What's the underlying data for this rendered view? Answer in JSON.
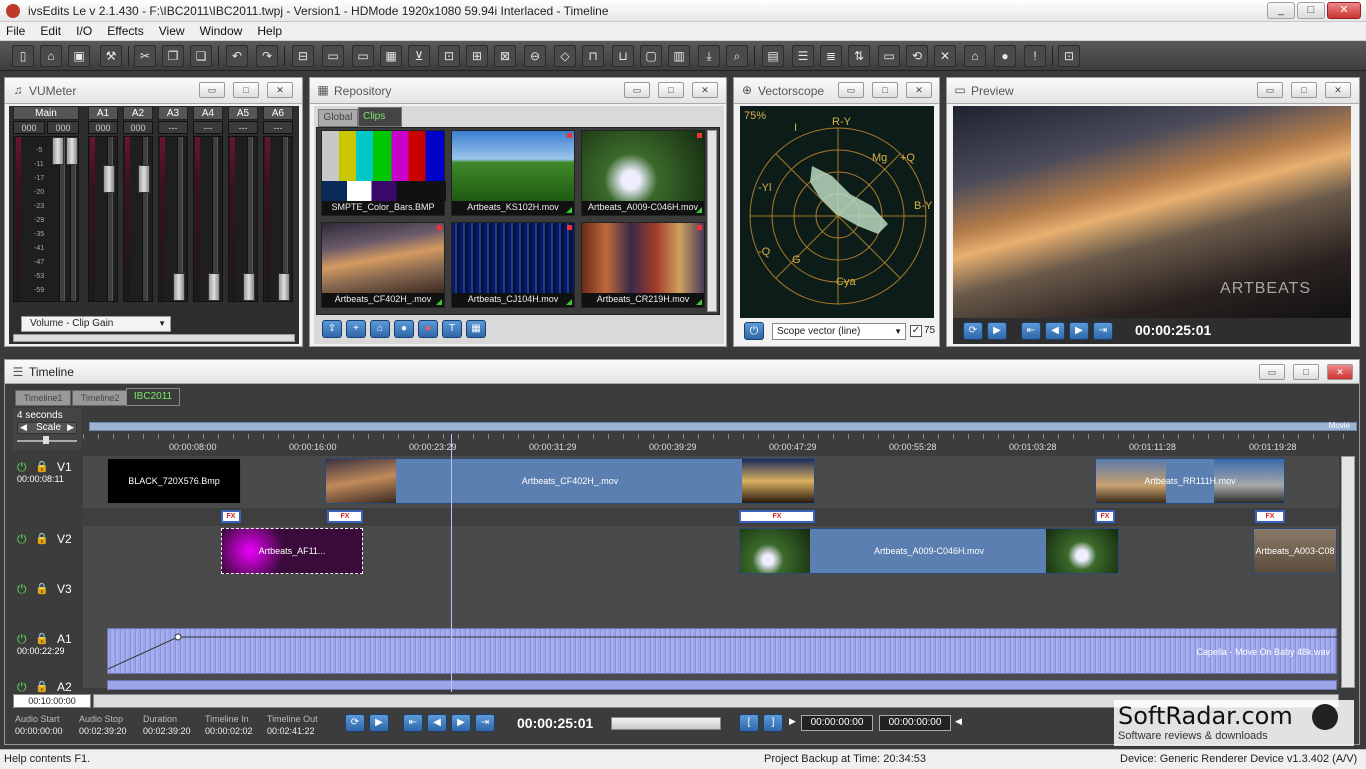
{
  "window": {
    "title": "ivsEdits Le v 2.1.430 - F:\\IBC2011\\IBC2011.twpj - Version1 - HDMode 1920x1080 59.94i Interlaced - Timeline",
    "min": "_",
    "max": "□",
    "close": "✕"
  },
  "menu": [
    "File",
    "Edit",
    "I/O",
    "Effects",
    "View",
    "Window",
    "Help"
  ],
  "vumeter": {
    "title": "VUMeter",
    "channels": [
      "Main",
      "A1",
      "A2",
      "A3",
      "A4",
      "A5",
      "A6"
    ],
    "values": [
      "000",
      "000",
      "000",
      "000",
      "---",
      "---",
      "---",
      "---"
    ],
    "scale": [
      "-5",
      "-11",
      "-17",
      "-20",
      "-23",
      "-29",
      "-35",
      "-41",
      "-47",
      "-53",
      "-59"
    ],
    "dropdown": "Volume - Clip Gain"
  },
  "repository": {
    "title": "Repository",
    "tabs": [
      "Global",
      "Clips"
    ],
    "clips": [
      "SMPTE_Color_Bars.BMP",
      "Artbeats_KS102H.mov",
      "Artbeats_A009-C046H.mov",
      "Artbeats_CF402H_.mov",
      "Artbeats_CJ104H.mov",
      "Artbeats_CR219H.mov"
    ]
  },
  "vectorscope": {
    "title": "Vectorscope",
    "percent": "75%",
    "labels": [
      "R-Y",
      "I",
      "Mg",
      "+Q",
      "B-Y",
      "-Yl",
      "-Q",
      "G",
      "Cya"
    ],
    "select": "Scope vector (line)",
    "check_label": "75"
  },
  "preview": {
    "title": "Preview",
    "watermark": "ARTBEATS",
    "timecode": "00:00:25:01"
  },
  "timeline": {
    "title": "Timeline",
    "tabs": [
      "Timeline1",
      "Timeline2",
      "IBC2011"
    ],
    "scale_duration": "4 seconds",
    "scale_label": "Scale",
    "movie_label": "Movie",
    "ruler": [
      "00:00:08:00",
      "00:00:16:00",
      "00:00:23:29",
      "00:00:31:29",
      "00:00:39:29",
      "00:00:47:29",
      "00:00:55:28",
      "00:01:03:28",
      "00:01:11:28",
      "00:01:19:28"
    ],
    "tracks": [
      {
        "name": "V1",
        "time": "00:00:08:11"
      },
      {
        "name": "V2",
        "time": ""
      },
      {
        "name": "V3",
        "time": ""
      },
      {
        "name": "A1",
        "time": "00:00:22:29"
      },
      {
        "name": "A2",
        "time": ""
      }
    ],
    "clips": {
      "v1_black": "BLACK_720X576.Bmp",
      "v1_cf402": "Artbeats_CF402H_.mov",
      "v1_rr": "Artbeats_RR111H.mov",
      "v2_bokeh": "Artbeats_AF11...",
      "v2_a009": "Artbeats_A009-C046H.mov",
      "v2_a003": "Artbeats_A003-C08",
      "a1_label": "Capella - Move On Baby 48k.wav"
    },
    "fx_label": "FX",
    "zoom_time": "00:10:00:00",
    "info_labels": [
      "Audio Start",
      "Audio Stop",
      "Duration",
      "Timeline In",
      "Timeline Out"
    ],
    "info_values": [
      "00:00:00:00",
      "00:02:39:20",
      "00:02:39:20",
      "00:00:02:02",
      "00:02:41:22"
    ],
    "timecode": "00:00:25:01",
    "mark_in": "00:00:00:00",
    "mark_out": "00:00:00:00"
  },
  "status": {
    "left": "Help contents F1.",
    "middle": "Project Backup at Time: 20:34:53",
    "right": "Device: Generic Renderer Device v1.3.402 (A/V)"
  },
  "watermark": {
    "name": "SoftRadar.com",
    "tagline": "Software reviews & downloads"
  }
}
